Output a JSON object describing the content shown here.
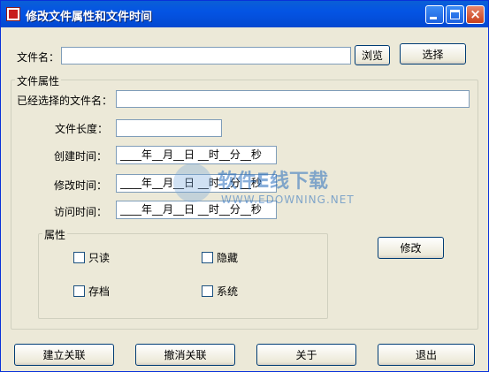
{
  "window": {
    "title": "修改文件属性和文件时间",
    "buttons": {
      "minimize": "",
      "maximize": "",
      "close": "×"
    }
  },
  "file_row": {
    "label": "文件名：",
    "value": "",
    "browse_label": "浏览",
    "select_label": "选择"
  },
  "file_attributes": {
    "legend": "文件属性",
    "selected_file_label": "已经选择的文件名：",
    "selected_file_value": "",
    "file_length_label": "文件长度：",
    "file_length_value": "",
    "created_label": "创建时间：",
    "modified_label": "修改时间：",
    "accessed_label": "访问时间：",
    "time_template": "____年__月__日 __时__分__秒"
  },
  "attributes": {
    "legend": "属性",
    "readonly": "只读",
    "hidden": "隐藏",
    "archive": "存档",
    "system": "系统"
  },
  "modify_label": "修改",
  "bottom_buttons": {
    "associate": "建立关联",
    "unassociate": "撤消关联",
    "about": "关于",
    "exit": "退出"
  },
  "watermark": {
    "cn": "软件E线下载",
    "en": "WWW.EDOWNING.NET"
  }
}
